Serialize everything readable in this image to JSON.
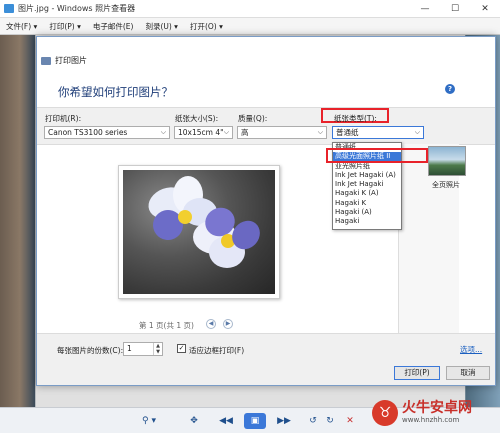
{
  "viewer": {
    "title": "图片.jpg - Windows 照片查看器",
    "menu": [
      "文件(F) ▾",
      "打印(P) ▾",
      "电子邮件(E)",
      "刻录(U) ▾",
      "打开(O) ▾"
    ],
    "controls": [
      "⚲ ▾",
      "✥",
      "◀◀",
      "▣",
      "▶▶",
      "↺",
      "↻",
      "✕"
    ],
    "win_buttons": [
      "—",
      "☐",
      "✕"
    ]
  },
  "dialog": {
    "title": "打印图片",
    "question": "你希望如何打印图片？",
    "printer": {
      "label": "打印机(R):",
      "value": "Canon TS3100 series"
    },
    "paper_size": {
      "label": "纸张大小(S):",
      "value": "10x15cm 4\""
    },
    "quality": {
      "label": "质量(Q):",
      "value": "高"
    },
    "paper_type": {
      "label": "纸张类型(T):",
      "value": "普通纸"
    },
    "paper_type_options": [
      "普通纸",
      "高级光面照片纸 II",
      "亚光照片纸",
      "Ink Jet Hagaki (A)",
      "Ink Jet Hagaki",
      "Hagaki K (A)",
      "Hagaki K",
      "Hagaki (A)",
      "Hagaki"
    ],
    "highlighted_option": "高级光面照片纸 II",
    "layout_thumb_label": "全页照片",
    "pager": "第 1 页(共 1 页)",
    "copies_label": "每张图片的份数(C):",
    "copies_value": "1",
    "fit_frame_label": "适应边框打印(F)",
    "fit_frame_checked": true,
    "options_link": "选项...",
    "print_button": "打印(P)",
    "cancel_button": "取消",
    "help_icon": "?"
  },
  "watermark": {
    "brand": "火牛安卓网",
    "url": "www.hnzhh.com"
  },
  "colors": {
    "accent": "#3b78d8",
    "highlight_red": "#e8222a",
    "question_blue": "#1e3d78"
  }
}
